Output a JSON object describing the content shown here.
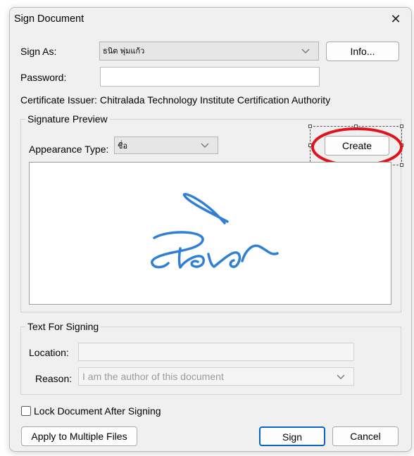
{
  "dialog": {
    "title": "Sign Document",
    "close_glyph": "✕"
  },
  "sign_as": {
    "label": "Sign As:",
    "value": "ธนิต พุ่มแก้ว",
    "info_button": "Info..."
  },
  "password": {
    "label": "Password:",
    "value": ""
  },
  "certificate": {
    "label": "Certificate Issuer:",
    "value": "Chitralada Technology Institute Certification Authority"
  },
  "signature_preview": {
    "legend": "Signature Preview",
    "appearance_label": "Appearance Type:",
    "appearance_value": "ชื่อ",
    "create_button": "Create",
    "signature_text": "ธนิต",
    "signature_color": "#2f7fd6",
    "annotation_color": "#e0141e"
  },
  "text_for_signing": {
    "legend": "Text For Signing",
    "location_label": "Location:",
    "location_value": "",
    "reason_label": "Reason:",
    "reason_placeholder": "I am the author of this document"
  },
  "lock_checkbox": {
    "label": "Lock Document After Signing",
    "checked": false
  },
  "footer": {
    "apply_multiple": "Apply to Multiple Files",
    "sign": "Sign",
    "cancel": "Cancel"
  }
}
